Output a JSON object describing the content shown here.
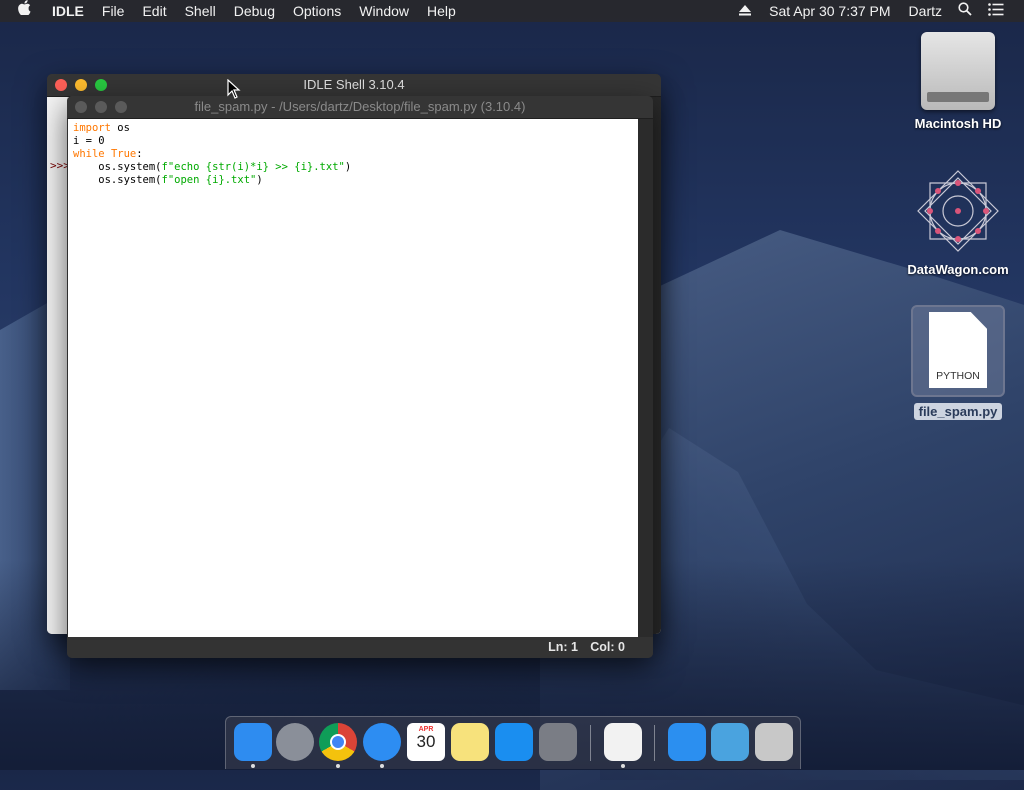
{
  "menubar": {
    "apple": "",
    "app": "IDLE",
    "items": [
      "File",
      "Edit",
      "Shell",
      "Debug",
      "Options",
      "Window",
      "Help"
    ],
    "clock": "Sat Apr 30  7:37 PM",
    "user": "Dartz"
  },
  "shell_window": {
    "title": "IDLE Shell 3.10.4",
    "prompt": ">>>"
  },
  "editor_window": {
    "title": "file_spam.py - /Users/dartz/Desktop/file_spam.py (3.10.4)",
    "code": [
      [
        {
          "t": "import",
          "c": "kw"
        },
        {
          "t": " os",
          "c": "plain"
        }
      ],
      [
        {
          "t": "i = 0",
          "c": "plain"
        }
      ],
      [
        {
          "t": "while",
          "c": "kw"
        },
        {
          "t": " ",
          "c": "plain"
        },
        {
          "t": "True",
          "c": "kw"
        },
        {
          "t": ":",
          "c": "plain"
        }
      ],
      [
        {
          "t": "    os.system(",
          "c": "plain"
        },
        {
          "t": "f\"echo {str(i)*i} >> {i}.txt\"",
          "c": "str"
        },
        {
          "t": ")",
          "c": "plain"
        }
      ],
      [
        {
          "t": "    os.system(",
          "c": "plain"
        },
        {
          "t": "f\"open {i}.txt\"",
          "c": "str"
        },
        {
          "t": ")",
          "c": "plain"
        }
      ]
    ],
    "status": {
      "ln": "Ln: 1",
      "col": "Col: 0"
    }
  },
  "desktop": {
    "hd_label": "Macintosh HD",
    "datawagon_label": "DataWagon.com",
    "file_label": "file_spam.py",
    "file_badge": "PYTHON"
  },
  "dock": {
    "items": [
      {
        "name": "finder-icon",
        "color": "#2e8cf0",
        "running": true
      },
      {
        "name": "launchpad-icon",
        "color": "#8a8f99",
        "running": false
      },
      {
        "name": "chrome-icon",
        "color": "#e8e8e8",
        "running": true
      },
      {
        "name": "safari-icon",
        "color": "#2d8df2",
        "running": true
      },
      {
        "name": "calendar-icon",
        "color": "#ffffff",
        "running": false
      },
      {
        "name": "notes-icon",
        "color": "#f7e27c",
        "running": false
      },
      {
        "name": "app-store-icon",
        "color": "#1a8ef0",
        "running": false
      },
      {
        "name": "system-preferences-icon",
        "color": "#7a7d85",
        "running": false
      },
      {
        "name": "idle-python-icon",
        "color": "#f2f2f2",
        "running": true
      },
      {
        "name": "applications-folder-icon",
        "color": "#2b8ff0",
        "running": false
      },
      {
        "name": "downloads-folder-icon",
        "color": "#4aa3df",
        "running": false
      },
      {
        "name": "trash-icon",
        "color": "#c8c8c8",
        "running": false
      }
    ],
    "calendar_month": "APR",
    "calendar_day": "30"
  }
}
